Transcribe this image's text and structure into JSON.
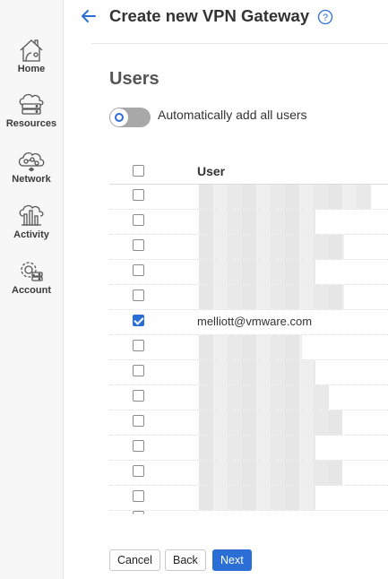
{
  "sidebar": {
    "items": [
      {
        "label": "Home",
        "icon": "home-icon"
      },
      {
        "label": "Resources",
        "icon": "cloud-server-icon"
      },
      {
        "label": "Network",
        "icon": "network-cloud-icon"
      },
      {
        "label": "Activity",
        "icon": "activity-chart-icon"
      },
      {
        "label": "Account",
        "icon": "gear-icon"
      }
    ]
  },
  "header": {
    "title": "Create new VPN Gateway",
    "help_icon_text": "?"
  },
  "users_section": {
    "title": "Users",
    "toggle_label": "Automatically add all users",
    "toggle_on": false
  },
  "users_table": {
    "column_header": "User",
    "visible_email": "melliott@vmware.com"
  },
  "footer": {
    "cancel_label": "Cancel",
    "back_label": "Back",
    "next_label": "Next"
  },
  "colors": {
    "accent": "#2b6fd6",
    "toggle_off": "#a8a8a8"
  }
}
